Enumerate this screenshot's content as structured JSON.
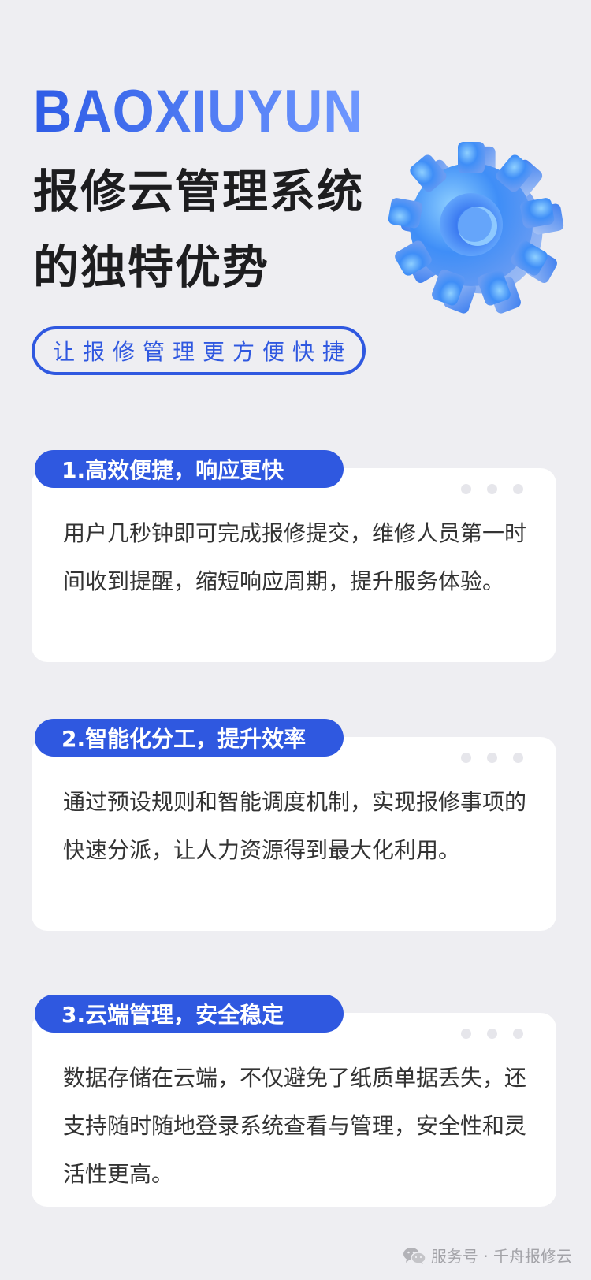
{
  "hero": {
    "brand": "BAOXIUYUN",
    "title_line1": "报修云管理系统",
    "title_line2": "的独特优势",
    "tagline": "让报修管理更方便快捷"
  },
  "features": [
    {
      "heading": "1.高效便捷，响应更快",
      "body": "用户几秒钟即可完成报修提交，维修人员第一时间收到提醒，缩短响应周期，提升服务体验。"
    },
    {
      "heading": "2.智能化分工，提升效率",
      "body": "通过预设规则和智能调度机制，实现报修事项的快速分派，让人力资源得到最大化利用。"
    },
    {
      "heading": "3.云端管理，安全稳定",
      "body": "数据存储在云端，不仅避免了纸质单据丢失，还支持随时随地登录系统查看与管理，安全性和灵活性更高。"
    }
  ],
  "footer": {
    "icon": "wechat-icon",
    "text": "服务号 · 千舟报修云"
  },
  "colors": {
    "accent": "#2f58e0",
    "background": "#eeeef2",
    "card": "#ffffff"
  }
}
